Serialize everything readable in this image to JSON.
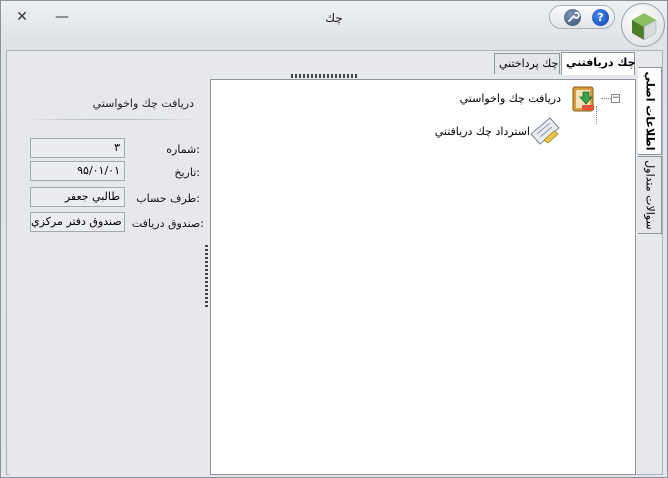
{
  "window": {
    "title": "چك",
    "close_glyph": "✕",
    "minimize_glyph": "—",
    "tools_icon": "wrench-icon",
    "help_label": "?"
  },
  "tabs": {
    "received": "چك دريافتني",
    "paid": "چك پرداختني"
  },
  "side_tabs": {
    "main": "اطلاعات اصلي",
    "docs": "سوالات متداول"
  },
  "form": {
    "section_title": "دريافت چك واخواستي",
    "fields": [
      {
        "label": "شماره:",
        "value": "۳"
      },
      {
        "label": "تاريخ:",
        "value": "۹۵/۰۱/۰۱"
      },
      {
        "label": "طرف حساب:",
        "value": "طالبي جعفر"
      },
      {
        "label": "صندوق دريافت:",
        "value": "صندوق دفتر مركزي"
      }
    ]
  },
  "tree": {
    "toggle": "−",
    "nodes": [
      {
        "label": "دريافت چك واخواستي",
        "icon": "cheque-receive-icon"
      },
      {
        "label": "استرداد چك دريافتني",
        "icon": "cheque-return-icon"
      }
    ]
  },
  "colors": {
    "help_blue": "#0d3fa8",
    "logo_green": "#5b8a2f"
  }
}
